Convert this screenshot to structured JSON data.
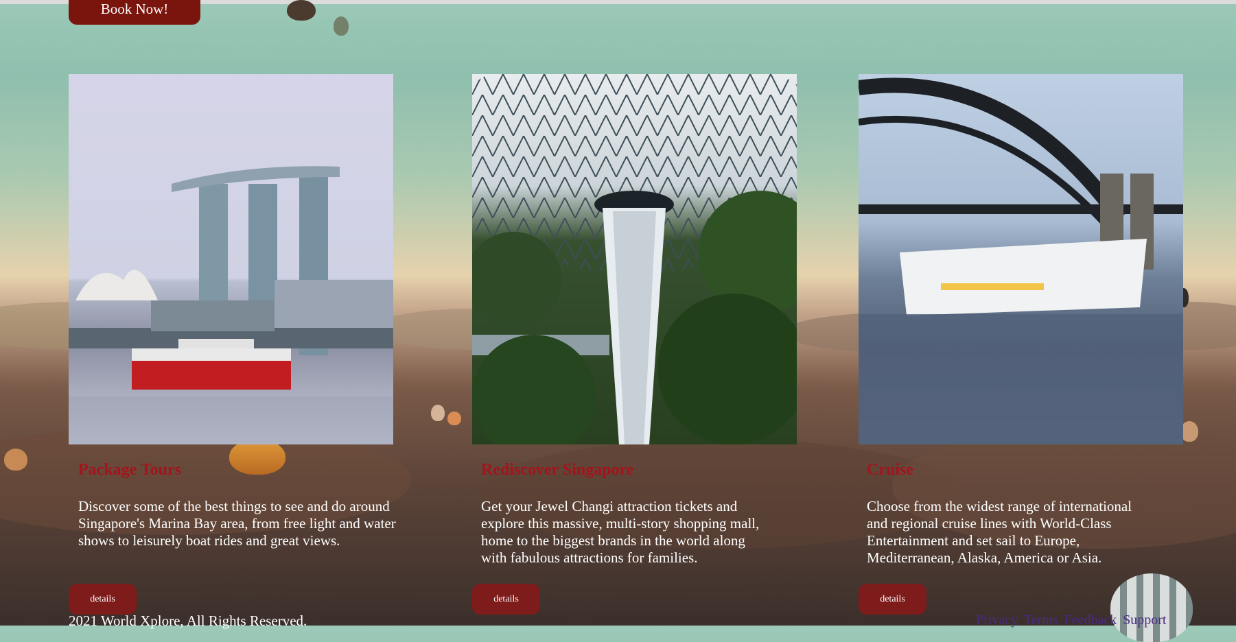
{
  "header": {
    "book_label": "Book Now!"
  },
  "cards": [
    {
      "title": "Package Tours",
      "description": "Discover some of the best things to see and do around Singapore's Marina Bay area, from free light and water shows to leisurely boat rides and great views.",
      "button_label": "details"
    },
    {
      "title": "Rediscover Singapore",
      "description": "Get your Jewel Changi attraction tickets and explore this massive, multi-story shopping mall, home to the biggest brands in the world along with fabulous attractions for families.",
      "button_label": "details"
    },
    {
      "title": "Cruise",
      "description": "Choose from the widest range of international and regional cruise lines with World-Class Entertainment and set sail to Europe, Mediterranean, Alaska, America or Asia.",
      "button_label": "details"
    }
  ],
  "footer": {
    "copyright": "2021 World Xplore, All Rights Reserved.",
    "links": [
      "Privacy",
      "Terms",
      "Feedback",
      "Support"
    ]
  },
  "colors": {
    "accent": "#7a150e",
    "title_red": "#a3141c",
    "link_purple": "#4a2a82"
  }
}
